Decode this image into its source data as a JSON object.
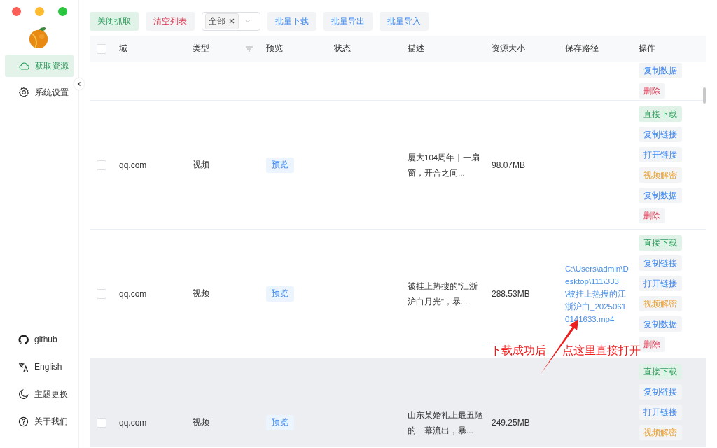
{
  "sidebar": {
    "nav": [
      {
        "label": "获取资源",
        "selected": true
      },
      {
        "label": "系统设置",
        "selected": false
      }
    ],
    "footer": [
      {
        "label": "github"
      },
      {
        "label": "English"
      },
      {
        "label": "主题更换"
      },
      {
        "label": "关于我们"
      }
    ]
  },
  "toolbar": [
    {
      "kind": "success",
      "label": "关闭抓取"
    },
    {
      "kind": "danger",
      "label": "清空列表"
    },
    {
      "kind": "select",
      "tag": "全部"
    },
    {
      "kind": "primary",
      "label": "批量下载"
    },
    {
      "kind": "primary",
      "label": "批量导出"
    },
    {
      "kind": "primary",
      "label": "批量导入"
    }
  ],
  "table": {
    "header_checked": false,
    "columns": [
      "域",
      "类型",
      "预览",
      "状态",
      "描述",
      "资源大小",
      "保存路径",
      "操作"
    ],
    "rows": [
      {
        "kind": "partial",
        "actions": [
          {
            "kind": "link",
            "label": "复制数据"
          },
          {
            "kind": "danger",
            "label": "删除"
          }
        ]
      },
      {
        "kind": "full",
        "checked": false,
        "highlighted": false,
        "domain": "qq.com",
        "type": "视频",
        "preview": "预览",
        "description": "厦大104周年｜一扇窗，开合之间...",
        "size": "98.07MB",
        "actions": [
          {
            "kind": "success",
            "label": "直接下载"
          },
          {
            "kind": "link",
            "label": "复制链接"
          },
          {
            "kind": "link",
            "label": "打开链接"
          },
          {
            "kind": "warning",
            "label": "视频解密"
          },
          {
            "kind": "link",
            "label": "复制数据"
          },
          {
            "kind": "danger",
            "label": "删除"
          }
        ]
      },
      {
        "kind": "full",
        "checked": false,
        "highlighted": false,
        "domain": "qq.com",
        "type": "视频",
        "preview": "预览",
        "description": "被挂上热搜的“江浙沪白月光”，暴...",
        "size": "288.53MB",
        "path": "C:\\Users\\admin\\Desktop\\111\\333\\被挂上热搜的江浙沪白_20250610141633.mp4",
        "actions": [
          {
            "kind": "success",
            "label": "直接下载"
          },
          {
            "kind": "link",
            "label": "复制链接"
          },
          {
            "kind": "link",
            "label": "打开链接"
          },
          {
            "kind": "warning",
            "label": "视频解密"
          },
          {
            "kind": "link",
            "label": "复制数据"
          },
          {
            "kind": "danger",
            "label": "删除"
          }
        ]
      },
      {
        "kind": "full",
        "checked": false,
        "highlighted": true,
        "domain": "qq.com",
        "type": "视频",
        "preview": "预览",
        "description": "山东某婚礼上最丑陋的一幕流出，暴...",
        "size": "249.25MB",
        "actions": [
          {
            "kind": "success",
            "label": "直接下载"
          },
          {
            "kind": "link",
            "label": "复制链接"
          },
          {
            "kind": "link",
            "label": "打开链接"
          },
          {
            "kind": "warning",
            "label": "视频解密"
          }
        ]
      }
    ]
  },
  "annotation": {
    "labels": [
      "下载成功后",
      "点这里直接打开"
    ]
  }
}
